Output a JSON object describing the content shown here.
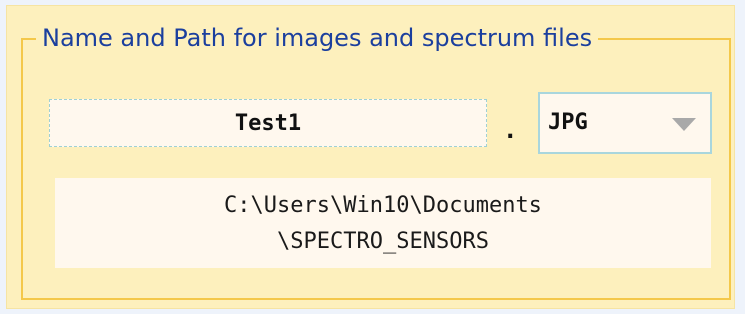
{
  "groupbox": {
    "title": "Name and Path for images and spectrum files"
  },
  "file_name": {
    "value": "Test1"
  },
  "separator": ".",
  "extension": {
    "selected": "JPG"
  },
  "path": {
    "line1": "C:\\Users\\Win10\\Documents",
    "line2": "\\SPECTRO_SENSORS"
  },
  "colors": {
    "panel_background": "#fdf0bd",
    "groupbox_border": "#f4c84a",
    "title_text": "#1b3f9e",
    "field_background": "#fff8ee",
    "field_border": "#a9d6dd"
  },
  "icons": {
    "dropdown": "chevron-down-icon"
  }
}
